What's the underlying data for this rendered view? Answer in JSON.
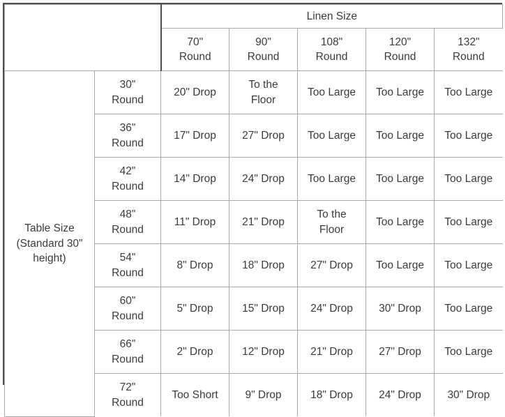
{
  "table": {
    "column_group_header": "Linen Size",
    "row_group_header": {
      "line1": "Table Size",
      "line2": "(Standard 30\"",
      "line3": "height)"
    },
    "column_headers": [
      {
        "size": "70\"",
        "shape": "Round"
      },
      {
        "size": "90\"",
        "shape": "Round"
      },
      {
        "size": "108\"",
        "shape": "Round"
      },
      {
        "size": "120\"",
        "shape": "Round"
      },
      {
        "size": "132\"",
        "shape": "Round"
      }
    ],
    "row_headers": [
      {
        "size": "30\"",
        "shape": "Round"
      },
      {
        "size": "36\"",
        "shape": "Round"
      },
      {
        "size": "42\"",
        "shape": "Round"
      },
      {
        "size": "48\"",
        "shape": "Round"
      },
      {
        "size": "54\"",
        "shape": "Round"
      },
      {
        "size": "60\"",
        "shape": "Round"
      },
      {
        "size": "66\"",
        "shape": "Round"
      },
      {
        "size": "72\"",
        "shape": "Round"
      }
    ],
    "rows": [
      {
        "cells": [
          {
            "line1": "20\" Drop",
            "line2": ""
          },
          {
            "line1": "To the",
            "line2": "Floor"
          },
          {
            "line1": "Too Large",
            "line2": ""
          },
          {
            "line1": "Too Large",
            "line2": ""
          },
          {
            "line1": "Too Large",
            "line2": ""
          }
        ]
      },
      {
        "cells": [
          {
            "line1": "17\" Drop",
            "line2": ""
          },
          {
            "line1": "27\" Drop",
            "line2": ""
          },
          {
            "line1": "Too Large",
            "line2": ""
          },
          {
            "line1": "Too Large",
            "line2": ""
          },
          {
            "line1": "Too Large",
            "line2": ""
          }
        ]
      },
      {
        "cells": [
          {
            "line1": "14\" Drop",
            "line2": ""
          },
          {
            "line1": "24\" Drop",
            "line2": ""
          },
          {
            "line1": "Too Large",
            "line2": ""
          },
          {
            "line1": "Too Large",
            "line2": ""
          },
          {
            "line1": "Too Large",
            "line2": ""
          }
        ]
      },
      {
        "cells": [
          {
            "line1": "11\" Drop",
            "line2": ""
          },
          {
            "line1": "21\" Drop",
            "line2": ""
          },
          {
            "line1": "To the",
            "line2": "Floor"
          },
          {
            "line1": "Too Large",
            "line2": ""
          },
          {
            "line1": "Too Large",
            "line2": ""
          }
        ]
      },
      {
        "cells": [
          {
            "line1": "8\" Drop",
            "line2": ""
          },
          {
            "line1": "18\" Drop",
            "line2": ""
          },
          {
            "line1": "27\" Drop",
            "line2": ""
          },
          {
            "line1": "Too Large",
            "line2": ""
          },
          {
            "line1": "Too Large",
            "line2": ""
          }
        ]
      },
      {
        "cells": [
          {
            "line1": "5\" Drop",
            "line2": ""
          },
          {
            "line1": "15\" Drop",
            "line2": ""
          },
          {
            "line1": "24\" Drop",
            "line2": ""
          },
          {
            "line1": "30\" Drop",
            "line2": ""
          },
          {
            "line1": "Too Large",
            "line2": ""
          }
        ]
      },
      {
        "cells": [
          {
            "line1": "2\" Drop",
            "line2": ""
          },
          {
            "line1": "12\" Drop",
            "line2": ""
          },
          {
            "line1": "21\" Drop",
            "line2": ""
          },
          {
            "line1": "27\" Drop",
            "line2": ""
          },
          {
            "line1": "Too Large",
            "line2": ""
          }
        ]
      },
      {
        "cells": [
          {
            "line1": "Too Short",
            "line2": ""
          },
          {
            "line1": "9\" Drop",
            "line2": ""
          },
          {
            "line1": "18\" Drop",
            "line2": ""
          },
          {
            "line1": "24\" Drop",
            "line2": ""
          },
          {
            "line1": "30\" Drop",
            "line2": ""
          }
        ]
      }
    ]
  },
  "colors": {
    "outer_border": "#4d4d4d",
    "inner_border": "#a8a8a8",
    "text": "#3b3b3b",
    "background": "#ffffff"
  }
}
